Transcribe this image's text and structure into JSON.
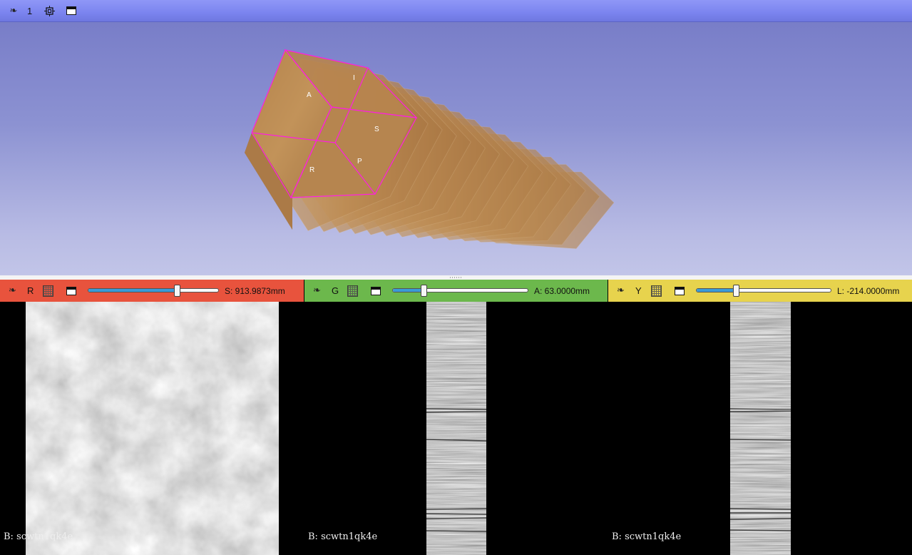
{
  "view3d": {
    "view_number": "1",
    "toolbar": {
      "pin_icon": "pin-icon",
      "center_icon": "center-view-icon",
      "maximize_icon": "maximize-view-icon"
    },
    "orientation_labels": {
      "anterior": "A",
      "inferior": "I",
      "superior": "S",
      "right": "R",
      "posterior": "P"
    },
    "background_top": "#7479c6",
    "background_bottom": "#c2c5e8",
    "roi_box_color": "#ff1ee0"
  },
  "slices": [
    {
      "id": "red",
      "color": "#e8533d",
      "view_letter": "R",
      "offset_label": "S: 913.9873mm",
      "slider_fraction": 0.69,
      "background_label": "B: scwtn1qk4e"
    },
    {
      "id": "green",
      "color": "#6cb84c",
      "view_letter": "G",
      "offset_label": "A: 63.0000mm",
      "slider_fraction": 0.22,
      "background_label": "B: scwtn1qk4e"
    },
    {
      "id": "yellow",
      "color": "#e7d34d",
      "view_letter": "Y",
      "offset_label": "L: -214.0000mm",
      "slider_fraction": 0.29,
      "background_label": "B: scwtn1qk4e"
    }
  ]
}
